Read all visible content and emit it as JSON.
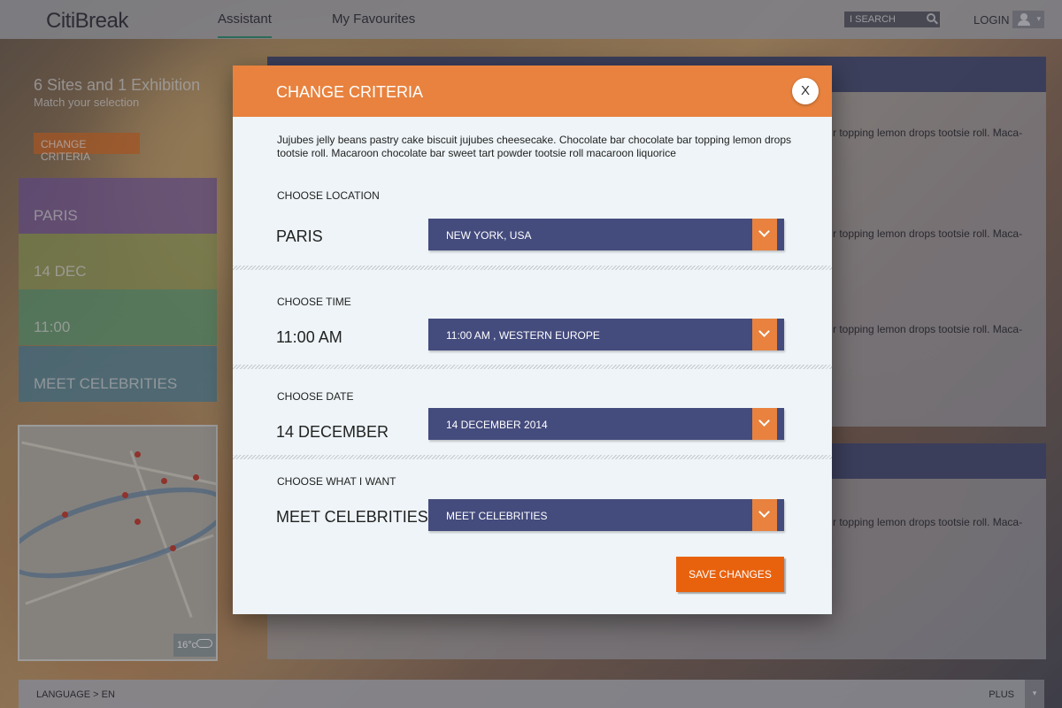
{
  "header": {
    "logo": "CitiBreak",
    "tabs": [
      {
        "label": "Assistant",
        "active": true
      },
      {
        "label": "My Favourites",
        "active": false
      }
    ],
    "search_label": "I SEARCH",
    "login_label": "LOGIN"
  },
  "summary": {
    "title": "6 Sites and 1 Exhibition",
    "subtitle": "Match your selection",
    "button": "CHANGE CRITERIA",
    "criteria": [
      {
        "label": "PARIS",
        "color": "#7a5aa8"
      },
      {
        "label": "14 DEC",
        "color": "#9aa858"
      },
      {
        "label": "11:00",
        "color": "#5aa878"
      },
      {
        "label": "MEET CELEBRITIES",
        "color": "#4a8aa8"
      }
    ]
  },
  "map": {
    "temperature": "16°c",
    "weather_icon": "cloud-icon"
  },
  "content": {
    "snippet": "r topping lemon drops tootsie roll. Maca-"
  },
  "footer": {
    "language": "LANGUAGE > EN",
    "plus": "PLUS"
  },
  "modal": {
    "title": "CHANGE CRITERIA",
    "close": "X",
    "intro": "Jujubes jelly beans pastry cake biscuit jujubes cheesecake. Chocolate bar chocolate bar topping lemon drops tootsie roll. Macaroon chocolate bar sweet tart powder tootsie roll macaroon liquorice",
    "sections": [
      {
        "label": "CHOOSE LOCATION",
        "value": "PARIS",
        "select": "NEW YORK, USA"
      },
      {
        "label": "CHOOSE TIME",
        "value": "11:00 AM",
        "select": "11:00 AM , WESTERN EUROPE"
      },
      {
        "label": "CHOOSE DATE",
        "value": "14 DECEMBER",
        "select": "14 DECEMBER 2014"
      },
      {
        "label": "CHOOSE WHAT I WANT",
        "value": "MEET CELEBRITIES",
        "select": "MEET CELEBRITIES"
      }
    ],
    "save": "SAVE CHANGES"
  },
  "colors": {
    "accent_orange": "#e8823e",
    "select_navy": "#444b7d",
    "save_orange": "#e8620e"
  }
}
